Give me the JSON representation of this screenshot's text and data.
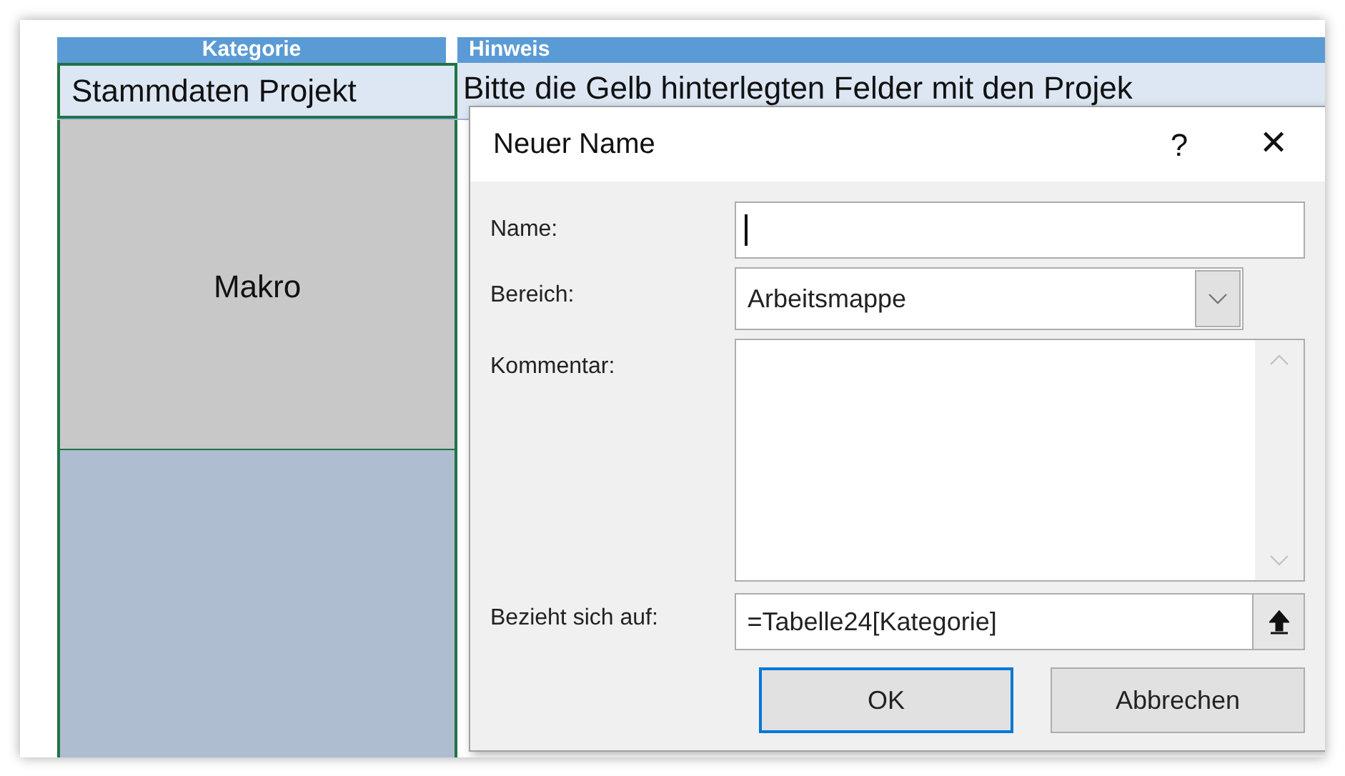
{
  "sheet": {
    "columns": [
      "Kategorie",
      "Hinweis"
    ],
    "rows": [
      {
        "kind": "header",
        "cells": [
          "Stammdaten Projekt",
          "Bitte die Gelb hinterlegten Felder mit den Projek"
        ]
      },
      {
        "kind": "macro",
        "cells": [
          "Makro"
        ]
      },
      {
        "kind": "blank",
        "cells": []
      }
    ]
  },
  "dialog": {
    "title": "Neuer Name",
    "help": "?",
    "close": "✕",
    "fields": [
      {
        "kind": "text",
        "label": "Name:"
      },
      {
        "kind": "dropdown",
        "label": "Bereich:",
        "value": "Arbeitsmappe"
      },
      {
        "kind": "textarea",
        "label": "Kommentar:"
      },
      {
        "kind": "reference",
        "label": "Bezieht sich auf:",
        "value": "=Tabelle24[Kategorie]"
      }
    ],
    "buttons": [
      {
        "label": "OK",
        "selected": true
      },
      {
        "label": "Abbrechen",
        "selected": false
      }
    ]
  }
}
